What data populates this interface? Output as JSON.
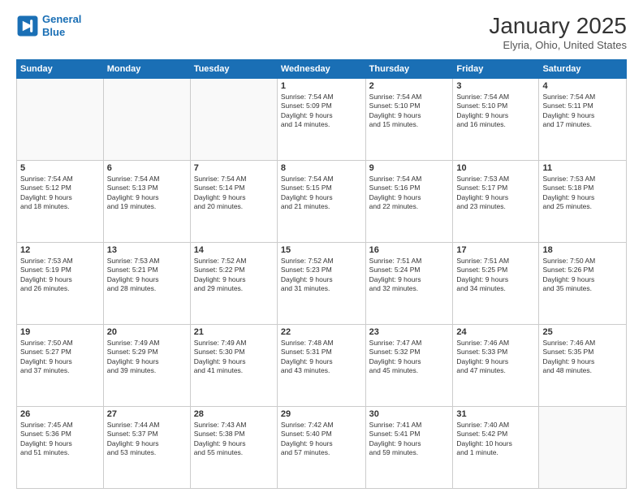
{
  "header": {
    "logo_line1": "General",
    "logo_line2": "Blue",
    "title": "January 2025",
    "subtitle": "Elyria, Ohio, United States"
  },
  "days_of_week": [
    "Sunday",
    "Monday",
    "Tuesday",
    "Wednesday",
    "Thursday",
    "Friday",
    "Saturday"
  ],
  "weeks": [
    [
      {
        "day": "",
        "info": ""
      },
      {
        "day": "",
        "info": ""
      },
      {
        "day": "",
        "info": ""
      },
      {
        "day": "1",
        "info": "Sunrise: 7:54 AM\nSunset: 5:09 PM\nDaylight: 9 hours\nand 14 minutes."
      },
      {
        "day": "2",
        "info": "Sunrise: 7:54 AM\nSunset: 5:10 PM\nDaylight: 9 hours\nand 15 minutes."
      },
      {
        "day": "3",
        "info": "Sunrise: 7:54 AM\nSunset: 5:10 PM\nDaylight: 9 hours\nand 16 minutes."
      },
      {
        "day": "4",
        "info": "Sunrise: 7:54 AM\nSunset: 5:11 PM\nDaylight: 9 hours\nand 17 minutes."
      }
    ],
    [
      {
        "day": "5",
        "info": "Sunrise: 7:54 AM\nSunset: 5:12 PM\nDaylight: 9 hours\nand 18 minutes."
      },
      {
        "day": "6",
        "info": "Sunrise: 7:54 AM\nSunset: 5:13 PM\nDaylight: 9 hours\nand 19 minutes."
      },
      {
        "day": "7",
        "info": "Sunrise: 7:54 AM\nSunset: 5:14 PM\nDaylight: 9 hours\nand 20 minutes."
      },
      {
        "day": "8",
        "info": "Sunrise: 7:54 AM\nSunset: 5:15 PM\nDaylight: 9 hours\nand 21 minutes."
      },
      {
        "day": "9",
        "info": "Sunrise: 7:54 AM\nSunset: 5:16 PM\nDaylight: 9 hours\nand 22 minutes."
      },
      {
        "day": "10",
        "info": "Sunrise: 7:53 AM\nSunset: 5:17 PM\nDaylight: 9 hours\nand 23 minutes."
      },
      {
        "day": "11",
        "info": "Sunrise: 7:53 AM\nSunset: 5:18 PM\nDaylight: 9 hours\nand 25 minutes."
      }
    ],
    [
      {
        "day": "12",
        "info": "Sunrise: 7:53 AM\nSunset: 5:19 PM\nDaylight: 9 hours\nand 26 minutes."
      },
      {
        "day": "13",
        "info": "Sunrise: 7:53 AM\nSunset: 5:21 PM\nDaylight: 9 hours\nand 28 minutes."
      },
      {
        "day": "14",
        "info": "Sunrise: 7:52 AM\nSunset: 5:22 PM\nDaylight: 9 hours\nand 29 minutes."
      },
      {
        "day": "15",
        "info": "Sunrise: 7:52 AM\nSunset: 5:23 PM\nDaylight: 9 hours\nand 31 minutes."
      },
      {
        "day": "16",
        "info": "Sunrise: 7:51 AM\nSunset: 5:24 PM\nDaylight: 9 hours\nand 32 minutes."
      },
      {
        "day": "17",
        "info": "Sunrise: 7:51 AM\nSunset: 5:25 PM\nDaylight: 9 hours\nand 34 minutes."
      },
      {
        "day": "18",
        "info": "Sunrise: 7:50 AM\nSunset: 5:26 PM\nDaylight: 9 hours\nand 35 minutes."
      }
    ],
    [
      {
        "day": "19",
        "info": "Sunrise: 7:50 AM\nSunset: 5:27 PM\nDaylight: 9 hours\nand 37 minutes."
      },
      {
        "day": "20",
        "info": "Sunrise: 7:49 AM\nSunset: 5:29 PM\nDaylight: 9 hours\nand 39 minutes."
      },
      {
        "day": "21",
        "info": "Sunrise: 7:49 AM\nSunset: 5:30 PM\nDaylight: 9 hours\nand 41 minutes."
      },
      {
        "day": "22",
        "info": "Sunrise: 7:48 AM\nSunset: 5:31 PM\nDaylight: 9 hours\nand 43 minutes."
      },
      {
        "day": "23",
        "info": "Sunrise: 7:47 AM\nSunset: 5:32 PM\nDaylight: 9 hours\nand 45 minutes."
      },
      {
        "day": "24",
        "info": "Sunrise: 7:46 AM\nSunset: 5:33 PM\nDaylight: 9 hours\nand 47 minutes."
      },
      {
        "day": "25",
        "info": "Sunrise: 7:46 AM\nSunset: 5:35 PM\nDaylight: 9 hours\nand 48 minutes."
      }
    ],
    [
      {
        "day": "26",
        "info": "Sunrise: 7:45 AM\nSunset: 5:36 PM\nDaylight: 9 hours\nand 51 minutes."
      },
      {
        "day": "27",
        "info": "Sunrise: 7:44 AM\nSunset: 5:37 PM\nDaylight: 9 hours\nand 53 minutes."
      },
      {
        "day": "28",
        "info": "Sunrise: 7:43 AM\nSunset: 5:38 PM\nDaylight: 9 hours\nand 55 minutes."
      },
      {
        "day": "29",
        "info": "Sunrise: 7:42 AM\nSunset: 5:40 PM\nDaylight: 9 hours\nand 57 minutes."
      },
      {
        "day": "30",
        "info": "Sunrise: 7:41 AM\nSunset: 5:41 PM\nDaylight: 9 hours\nand 59 minutes."
      },
      {
        "day": "31",
        "info": "Sunrise: 7:40 AM\nSunset: 5:42 PM\nDaylight: 10 hours\nand 1 minute."
      },
      {
        "day": "",
        "info": ""
      }
    ]
  ]
}
